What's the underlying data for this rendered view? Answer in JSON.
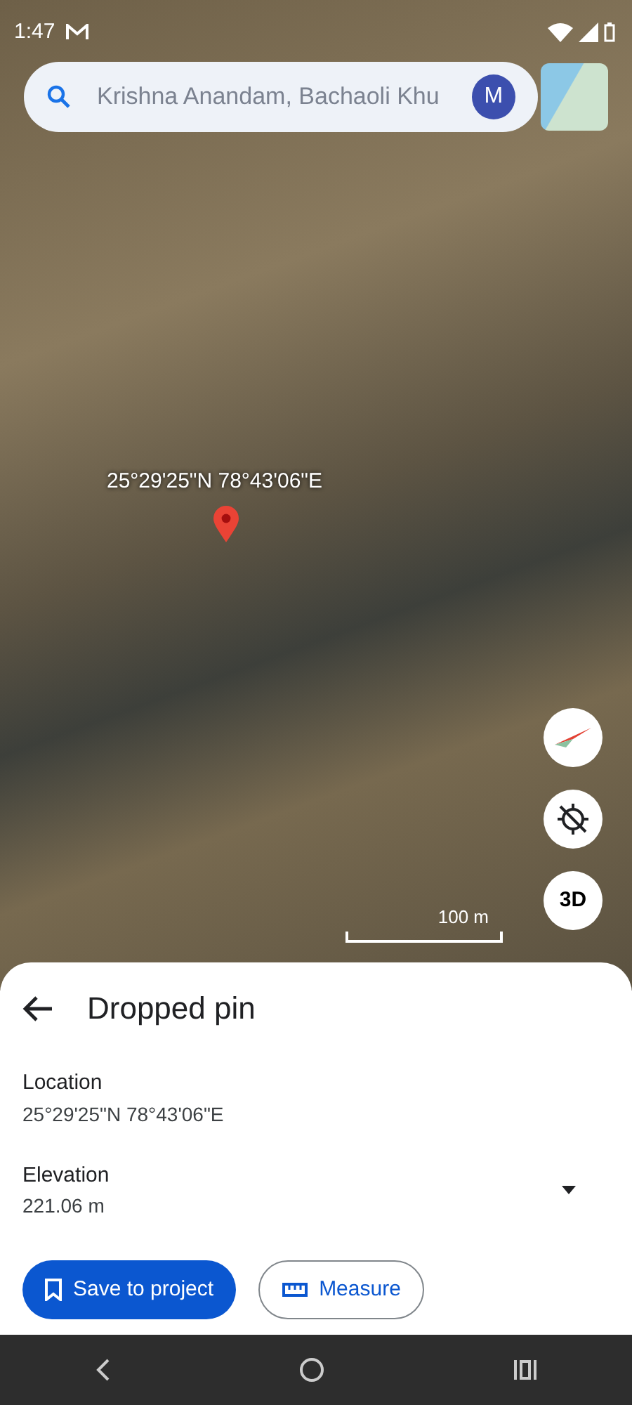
{
  "status_bar": {
    "time": "1:47"
  },
  "search": {
    "value": "Krishna Anandam, Bachaoli Khu",
    "avatar": "M"
  },
  "map": {
    "pin_label": "25°29'25\"N 78°43'06\"E",
    "scale": "100 m",
    "view_button": "3D"
  },
  "sheet": {
    "title": "Dropped pin",
    "fields": [
      {
        "label": "Location",
        "value": "25°29'25\"N 78°43'06\"E",
        "expandable": false
      },
      {
        "label": "Elevation",
        "value": "221.06 m",
        "expandable": true
      }
    ],
    "buttons": [
      {
        "label": "Save to project",
        "kind": "primary"
      },
      {
        "label": "Measure",
        "kind": "outline"
      }
    ]
  }
}
